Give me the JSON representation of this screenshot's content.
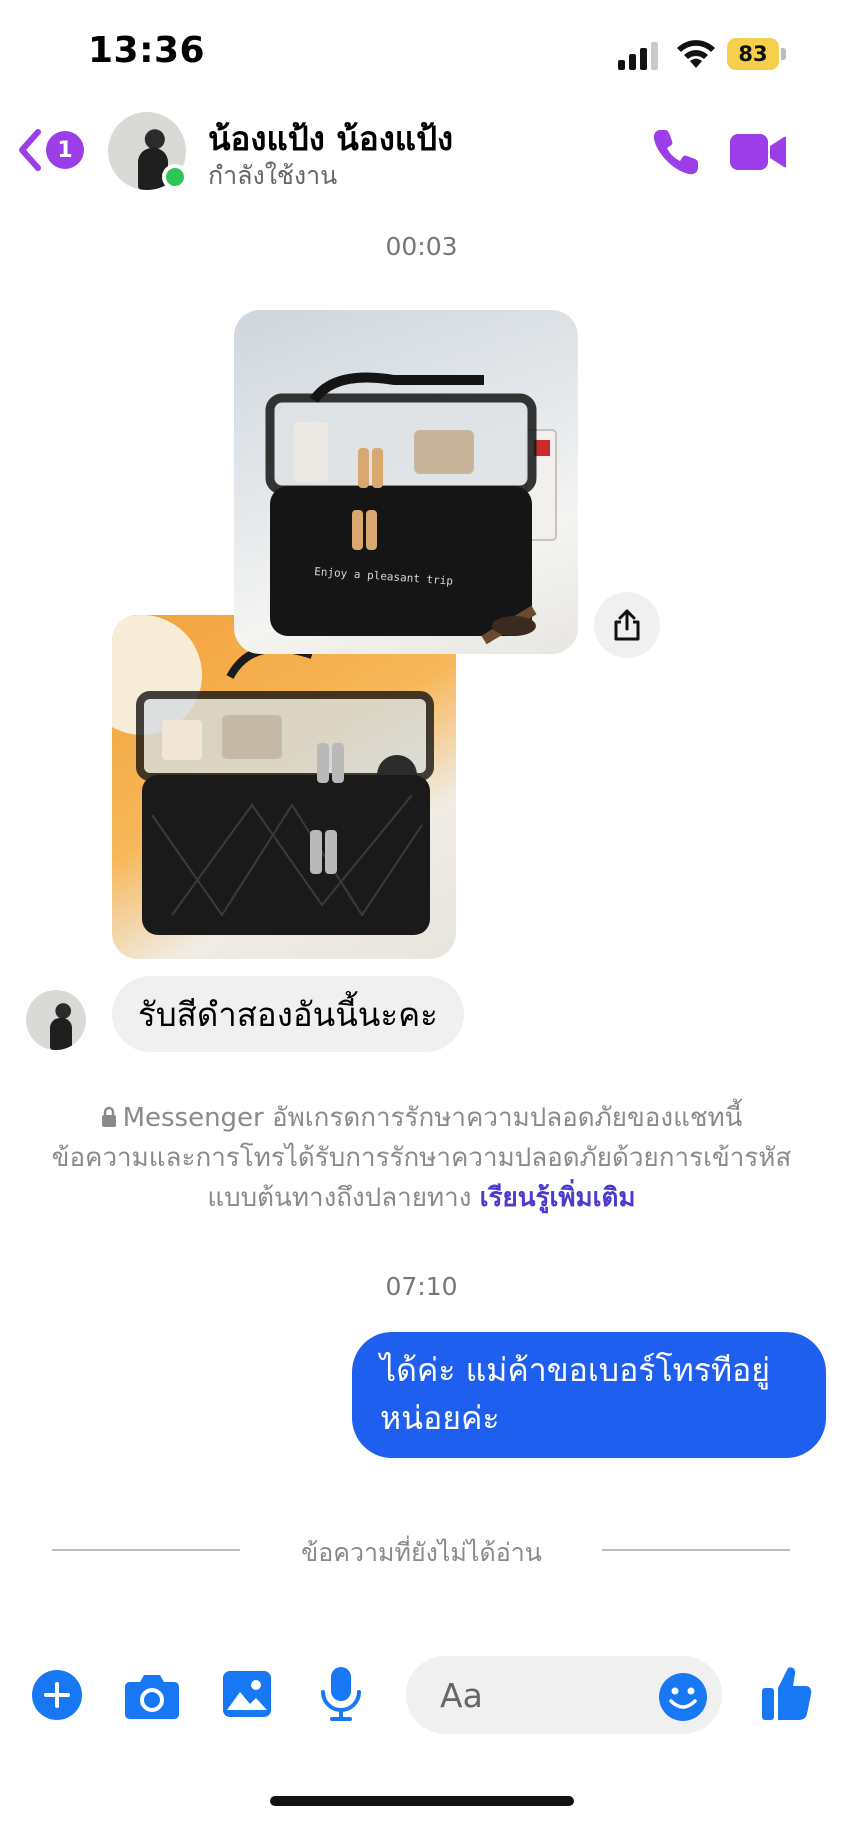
{
  "status_bar": {
    "time": "13:36",
    "battery": "83"
  },
  "header": {
    "unread_count": "1",
    "contact_name": "น้องแป้ง น้องแป้ง",
    "contact_status": "กำลังใช้งาน"
  },
  "chat": {
    "timestamp_1": "00:03",
    "photo1_caption": "Enjoy a pleasant trip",
    "incoming_message": "รับสีดำสองอันนี้นะคะ",
    "e2ee_line1": "Messenger อัพเกรดการรักษาความปลอดภัยของแชทนี้",
    "e2ee_line2": "ข้อความและการโทรได้รับการรักษาความปลอดภัยด้วยการเข้ารหัส",
    "e2ee_line3": "แบบต้นทางถึงปลายทาง",
    "e2ee_link": "เรียนรู้เพิ่มเติม",
    "timestamp_2": "07:10",
    "outgoing_line1": "ได้ค่ะ แม่ค้าขอเบอร์โทรทีอยู่",
    "outgoing_line2": "หน่อยค่ะ",
    "unread_divider": "ข้อความที่ยังไม่ได้อ่าน"
  },
  "composer": {
    "placeholder": "Aa"
  },
  "colors": {
    "header_accent": "#9b3ee8",
    "outgoing_bubble": "#1f5fef",
    "composer_icons": "#1877f2",
    "online": "#31c653"
  },
  "icons": [
    "back-chevron-icon",
    "phone-icon",
    "video-camera-icon",
    "share-icon",
    "lock-icon",
    "plus-icon",
    "camera-icon",
    "image-icon",
    "microphone-icon",
    "emoji-icon",
    "thumbs-up-icon"
  ]
}
